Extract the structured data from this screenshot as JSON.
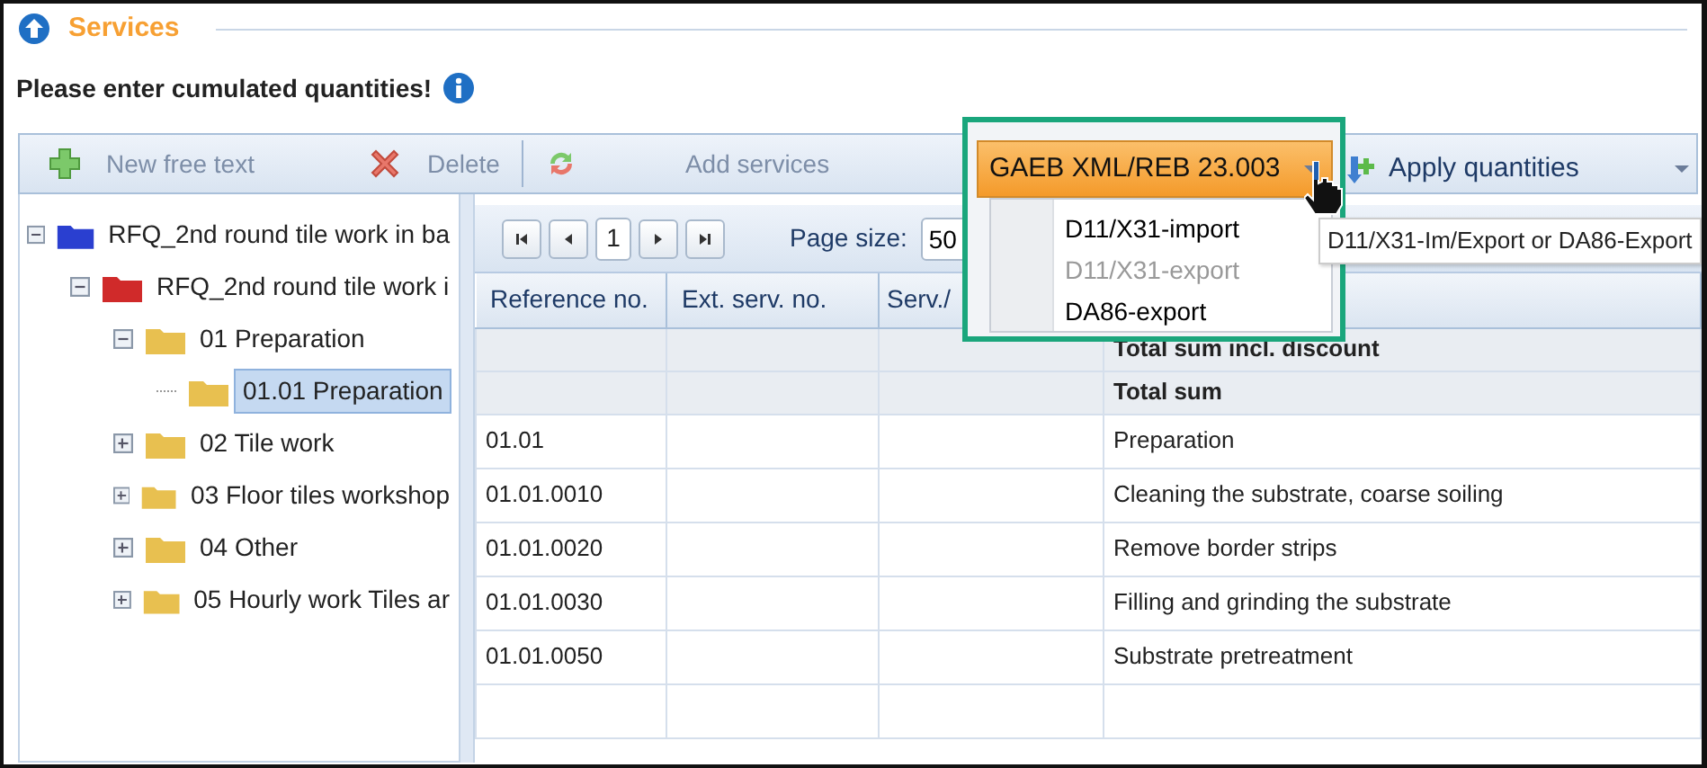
{
  "header": {
    "title": "Services"
  },
  "instruction": "Please enter cumulated quantities!",
  "toolbar": [
    {
      "label": "New free text",
      "kind": "add",
      "disabled": true
    },
    {
      "label": "Delete",
      "kind": "delete",
      "disabled": true
    },
    {
      "label": "Add services",
      "kind": "refresh",
      "disabled": true
    }
  ],
  "export_menu": {
    "label": "GAEB XML/REB 23.003",
    "expanded": true,
    "items": [
      {
        "label": "D11/X31-import",
        "disabled": false
      },
      {
        "label": "D11/X31-export",
        "disabled": true
      },
      {
        "label": "DA86-export",
        "disabled": false
      }
    ]
  },
  "apply_button": {
    "label": "Apply quantities"
  },
  "tooltip": "D11/X31-Im/Export or DA86-Export",
  "tree": [
    {
      "label": "RFQ_2nd round tile work in ba",
      "color": "#2a3fd0",
      "expanded": true,
      "selected": false,
      "children": [
        {
          "label": "RFQ_2nd round tile work i",
          "color": "#d02a2a",
          "expanded": true,
          "selected": false,
          "children": [
            {
              "label": "01 Preparation",
              "color": "#e8c050",
              "expanded": true,
              "selected": false,
              "children": [
                {
                  "label": "01.01 Preparation",
                  "color": "#e8c050",
                  "selected": true
                }
              ]
            },
            {
              "label": "02 Tile work",
              "color": "#e8c050",
              "expanded": false,
              "selected": false
            },
            {
              "label": "03 Floor tiles workshop",
              "color": "#e8c050",
              "expanded": false,
              "selected": false
            },
            {
              "label": "04 Other",
              "color": "#e8c050",
              "expanded": false,
              "selected": false
            },
            {
              "label": "05 Hourly work Tiles ar",
              "color": "#e8c050",
              "expanded": false,
              "selected": false
            }
          ]
        }
      ]
    }
  ],
  "pager": {
    "page": "1",
    "page_size_label": "Page size:",
    "page_size": "50"
  },
  "table": {
    "columns": [
      "Reference no.",
      "Ext. serv. no.",
      "Serv./"
    ],
    "rows": [
      {
        "kind": "sum",
        "cells": [
          "",
          "",
          "",
          "Total sum incl. discount"
        ]
      },
      {
        "kind": "sum",
        "cells": [
          "",
          "",
          "",
          "Total sum"
        ]
      },
      {
        "kind": "item",
        "cells": [
          "01.01",
          "",
          "",
          "Preparation"
        ]
      },
      {
        "kind": "item",
        "cells": [
          "01.01.0010",
          "",
          "",
          "Cleaning the substrate, coarse soiling"
        ]
      },
      {
        "kind": "item",
        "cells": [
          "01.01.0020",
          "",
          "",
          "Remove border strips"
        ]
      },
      {
        "kind": "item",
        "cells": [
          "01.01.0030",
          "",
          "",
          "Filling and grinding the substrate"
        ]
      },
      {
        "kind": "item",
        "cells": [
          "01.01.0050",
          "",
          "",
          "Substrate pretreatment"
        ]
      }
    ]
  }
}
